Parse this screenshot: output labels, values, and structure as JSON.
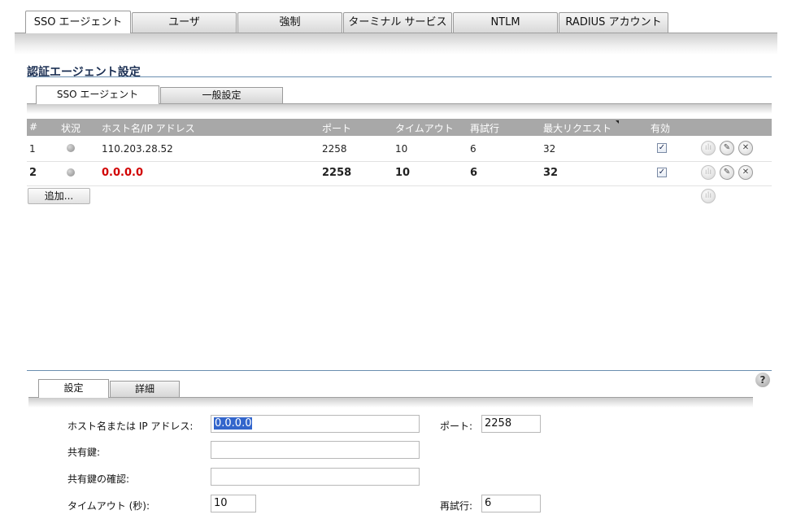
{
  "top_tabs": [
    "SSO エージェント",
    "ユーザ",
    "強制",
    "ターミナル サービス",
    "NTLM",
    "RADIUS アカウント"
  ],
  "section_title": "認証エージェント設定",
  "sub_tabs": [
    "SSO エージェント",
    "一般設定"
  ],
  "table": {
    "headers": [
      "#",
      "状況",
      "ホスト名/IP アドレス",
      "ポート",
      "タイムアウト",
      "再試行",
      "最大リクエスト",
      "有効"
    ],
    "rows": [
      {
        "num": "1",
        "host": "110.203.28.52",
        "port": "2258",
        "timeout": "10",
        "retries": "6",
        "max_requests": "32",
        "enabled": true
      },
      {
        "num": "2",
        "host": "0.0.0.0",
        "port": "2258",
        "timeout": "10",
        "retries": "6",
        "max_requests": "32",
        "enabled": true
      }
    ]
  },
  "add_button": "追加...",
  "detail_tabs": [
    "設定",
    "詳細"
  ],
  "form": {
    "host_label": "ホスト名または IP アドレス:",
    "host_value": "0.0.0.0",
    "port_label": "ポート:",
    "port_value": "2258",
    "secret_label": "共有鍵:",
    "secret_value": "",
    "confirm_label": "共有鍵の確認:",
    "confirm_value": "",
    "timeout_label": "タイムアウト (秒):",
    "timeout_value": "10",
    "retries_label": "再試行:",
    "retries_value": "6"
  },
  "icons": {
    "row_actions": [
      "statistics-icon",
      "edit-icon",
      "delete-icon"
    ],
    "help": "help-icon"
  },
  "colors": {
    "header_bg": "#a8a8a8",
    "title": "#1a2e52",
    "highlight_host": "#d10000",
    "selection": "#3366cc"
  }
}
